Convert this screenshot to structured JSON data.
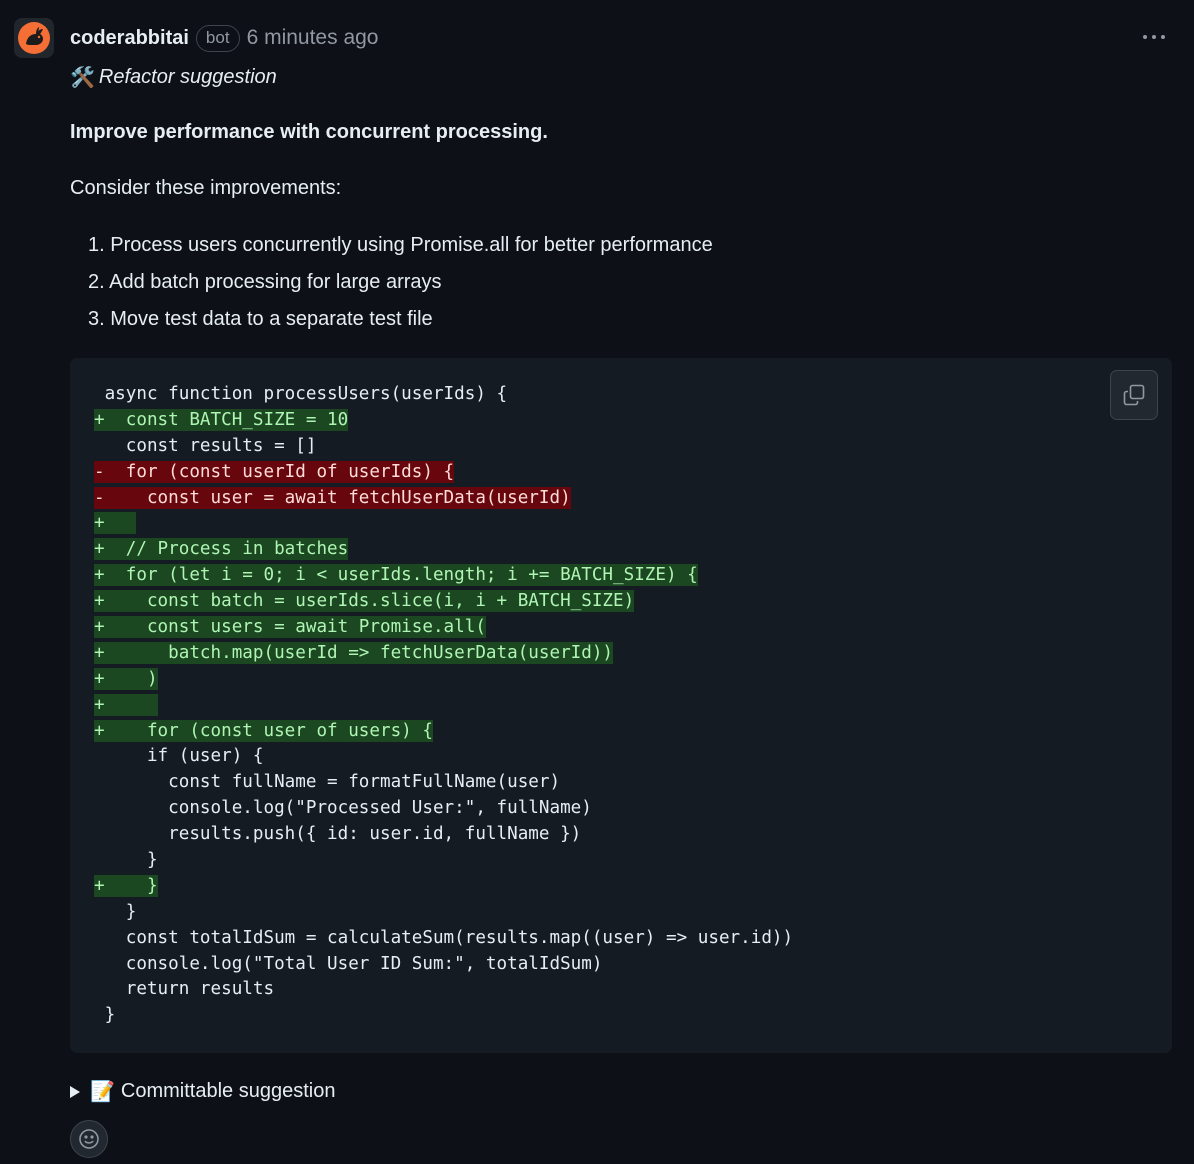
{
  "comment": {
    "author": "coderabbitai",
    "badge": "bot",
    "timestamp": "6 minutes ago",
    "avatar_icon": "rabbit-logo-icon",
    "avatar_color": "#f56e35",
    "refactor_icon": "🛠️",
    "refactor_label": "Refactor suggestion",
    "headline": "Improve performance with concurrent processing.",
    "intro": "Consider these improvements:",
    "improvements": [
      "1. Process users concurrently using Promise.all for better performance",
      "2. Add batch processing for large arrays",
      "3. Move test data to a separate test file"
    ],
    "code_lines": [
      {
        "type": "ctx",
        "text": " async function processUsers(userIds) {"
      },
      {
        "type": "add",
        "text": "+  const BATCH_SIZE = 10"
      },
      {
        "type": "ctx",
        "text": "   const results = []"
      },
      {
        "type": "del",
        "text": "-  for (const userId of userIds) {"
      },
      {
        "type": "del",
        "text": "-    const user = await fetchUserData(userId)"
      },
      {
        "type": "add",
        "text": "+   "
      },
      {
        "type": "add",
        "text": "+  // Process in batches"
      },
      {
        "type": "add",
        "text": "+  for (let i = 0; i < userIds.length; i += BATCH_SIZE) {"
      },
      {
        "type": "add",
        "text": "+    const batch = userIds.slice(i, i + BATCH_SIZE)"
      },
      {
        "type": "add",
        "text": "+    const users = await Promise.all("
      },
      {
        "type": "add",
        "text": "+      batch.map(userId => fetchUserData(userId))"
      },
      {
        "type": "add",
        "text": "+    )"
      },
      {
        "type": "add",
        "text": "+     "
      },
      {
        "type": "add",
        "text": "+    for (const user of users) {"
      },
      {
        "type": "ctx",
        "text": "     if (user) {"
      },
      {
        "type": "ctx",
        "text": "       const fullName = formatFullName(user)"
      },
      {
        "type": "ctx",
        "text": "       console.log(\"Processed User:\", fullName)"
      },
      {
        "type": "ctx",
        "text": "       results.push({ id: user.id, fullName })"
      },
      {
        "type": "ctx",
        "text": "     }"
      },
      {
        "type": "add",
        "text": "+    }"
      },
      {
        "type": "ctx",
        "text": "   }"
      },
      {
        "type": "ctx",
        "text": "   const totalIdSum = calculateSum(results.map((user) => user.id))"
      },
      {
        "type": "ctx",
        "text": "   console.log(\"Total User ID Sum:\", totalIdSum)"
      },
      {
        "type": "ctx",
        "text": "   return results"
      },
      {
        "type": "ctx",
        "text": " }"
      }
    ],
    "committable_icon": "📝",
    "committable_label": "Committable suggestion"
  }
}
